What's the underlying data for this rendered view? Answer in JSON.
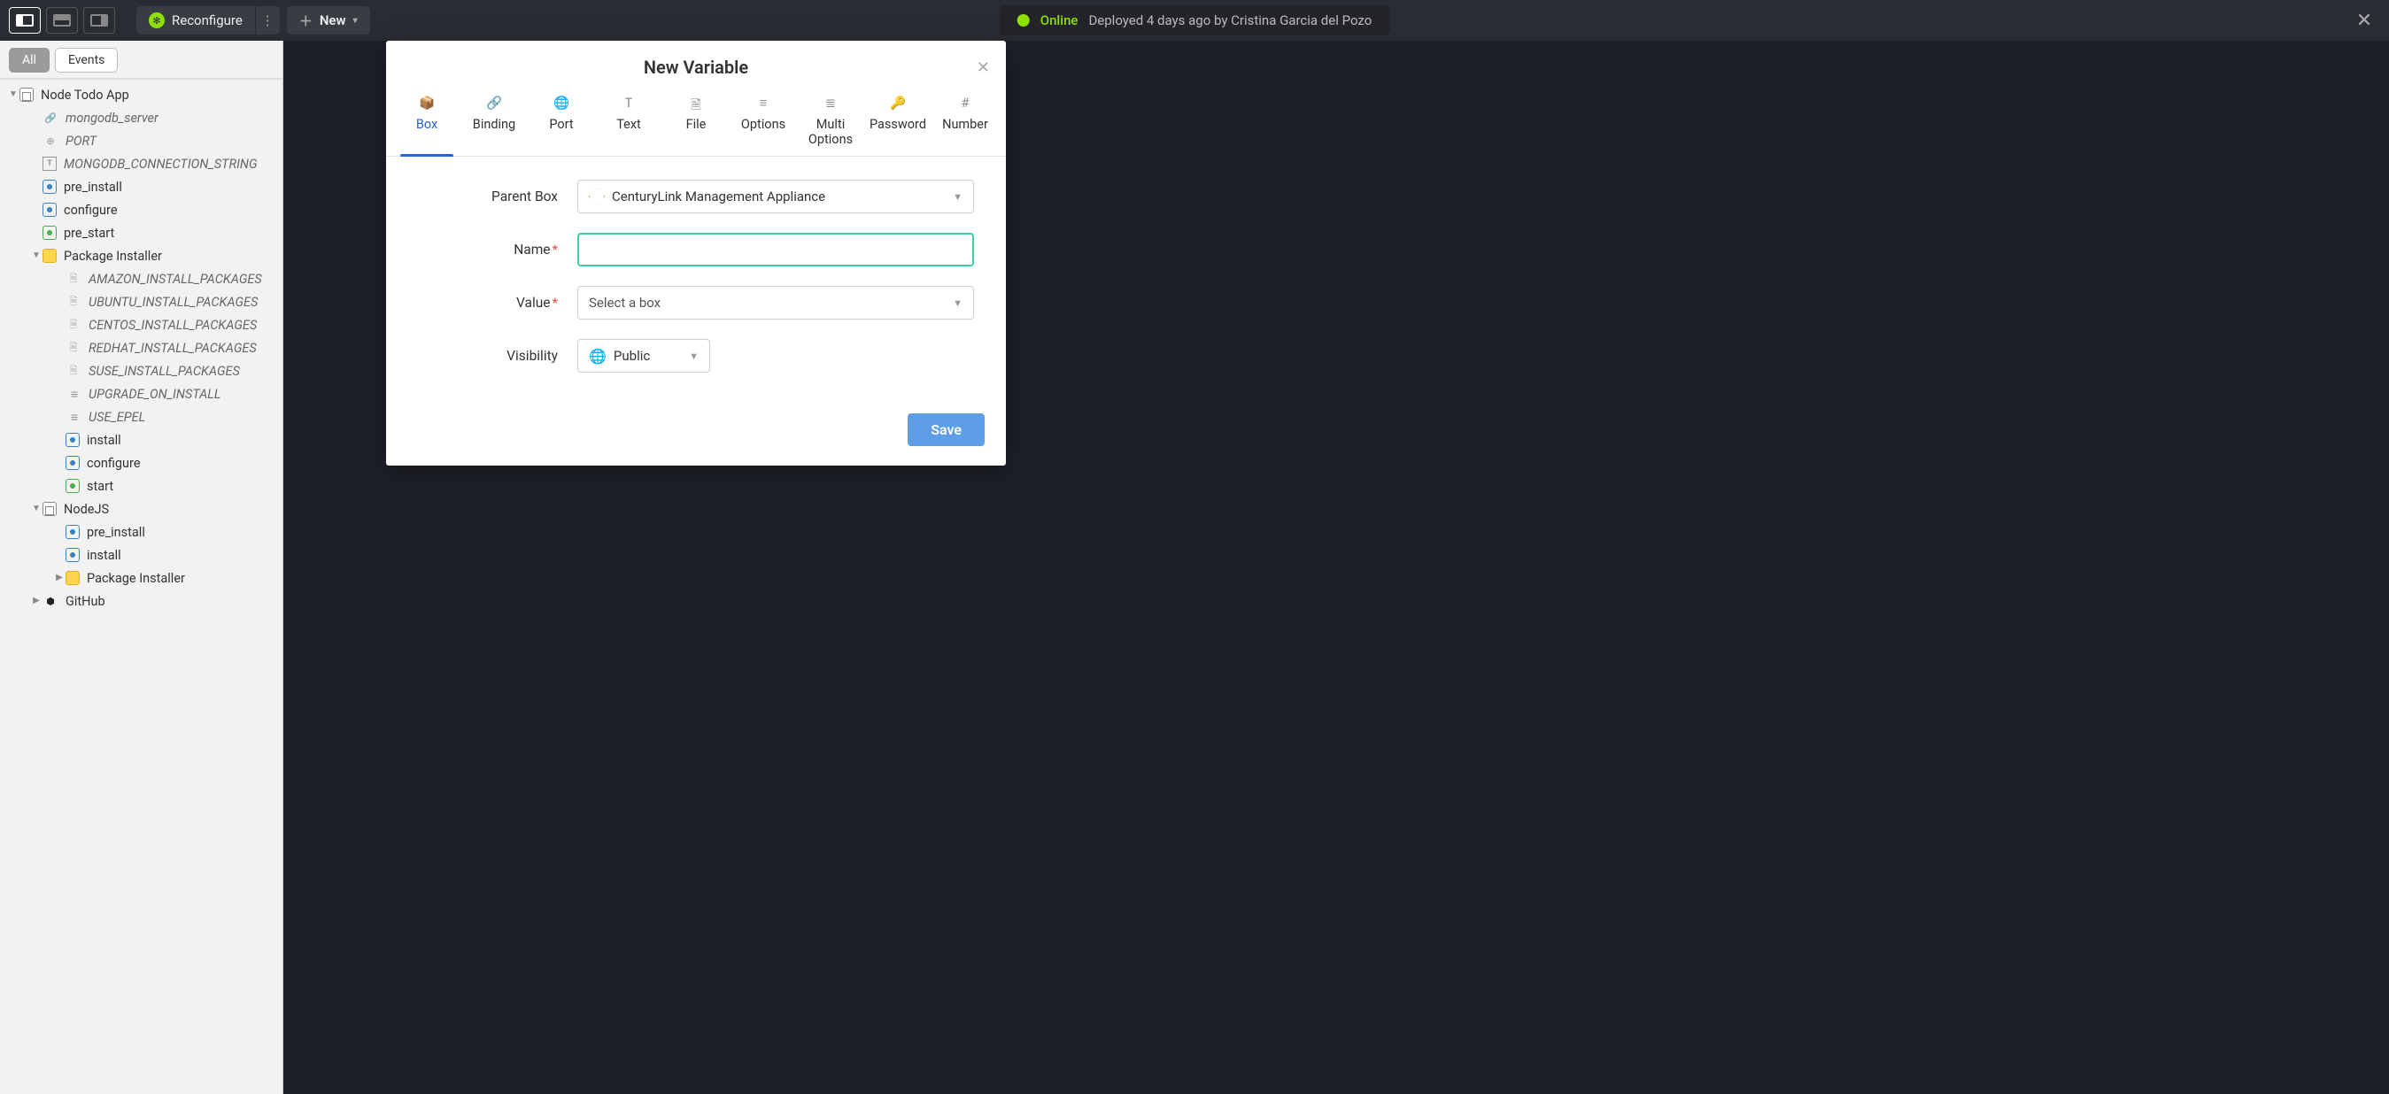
{
  "topbar": {
    "reconfigure_label": "Reconfigure",
    "new_label": "New",
    "status_label": "Online",
    "deploy_info": "Deployed 4 days ago by Cristina Garcia del Pozo"
  },
  "sidebar": {
    "tabs": {
      "all": "All",
      "events": "Events"
    },
    "tree": [
      {
        "d": 0,
        "caret": "down",
        "icon": "app",
        "label": "Node Todo App"
      },
      {
        "d": 1,
        "caret": "none",
        "icon": "link",
        "label": "mongodb_server",
        "italic": true
      },
      {
        "d": 1,
        "caret": "none",
        "icon": "port",
        "label": "PORT",
        "italic": true
      },
      {
        "d": 1,
        "caret": "none",
        "icon": "text",
        "label": "MONGODB_CONNECTION_STRING",
        "italic": true
      },
      {
        "d": 1,
        "caret": "none",
        "icon": "script",
        "label": "pre_install"
      },
      {
        "d": 1,
        "caret": "none",
        "icon": "script",
        "label": "configure"
      },
      {
        "d": 1,
        "caret": "none",
        "icon": "scriptg",
        "label": "pre_start"
      },
      {
        "d": 1,
        "caret": "down",
        "icon": "pkg",
        "label": "Package Installer"
      },
      {
        "d": 2,
        "caret": "none",
        "icon": "file",
        "label": "AMAZON_INSTALL_PACKAGES",
        "italic": true
      },
      {
        "d": 2,
        "caret": "none",
        "icon": "file",
        "label": "UBUNTU_INSTALL_PACKAGES",
        "italic": true
      },
      {
        "d": 2,
        "caret": "none",
        "icon": "file",
        "label": "CENTOS_INSTALL_PACKAGES",
        "italic": true
      },
      {
        "d": 2,
        "caret": "none",
        "icon": "file",
        "label": "REDHAT_INSTALL_PACKAGES",
        "italic": true
      },
      {
        "d": 2,
        "caret": "none",
        "icon": "file",
        "label": "SUSE_INSTALL_PACKAGES",
        "italic": true
      },
      {
        "d": 2,
        "caret": "none",
        "icon": "opts",
        "label": "UPGRADE_ON_INSTALL",
        "italic": true
      },
      {
        "d": 2,
        "caret": "none",
        "icon": "opts",
        "label": "USE_EPEL",
        "italic": true
      },
      {
        "d": 2,
        "caret": "none",
        "icon": "script",
        "label": "install"
      },
      {
        "d": 2,
        "caret": "none",
        "icon": "script",
        "label": "configure"
      },
      {
        "d": 2,
        "caret": "none",
        "icon": "scriptg",
        "label": "start"
      },
      {
        "d": 1,
        "caret": "down",
        "icon": "app",
        "label": "NodeJS"
      },
      {
        "d": 2,
        "caret": "none",
        "icon": "script",
        "label": "pre_install"
      },
      {
        "d": 2,
        "caret": "none",
        "icon": "script",
        "label": "install"
      },
      {
        "d": 2,
        "caret": "right",
        "icon": "pkg",
        "label": "Package Installer"
      },
      {
        "d": 1,
        "caret": "right",
        "icon": "gh",
        "label": "GitHub"
      }
    ]
  },
  "modal": {
    "title": "New Variable",
    "tabs": [
      "Box",
      "Binding",
      "Port",
      "Text",
      "File",
      "Options",
      "Multi Options",
      "Password",
      "Number"
    ],
    "active_tab": 0,
    "form": {
      "parent_label": "Parent Box",
      "parent_value": "CenturyLink Management Appliance",
      "name_label": "Name",
      "name_value": "",
      "value_label": "Value",
      "value_placeholder": "Select a box",
      "visibility_label": "Visibility",
      "visibility_value": "Public"
    },
    "save_label": "Save"
  }
}
